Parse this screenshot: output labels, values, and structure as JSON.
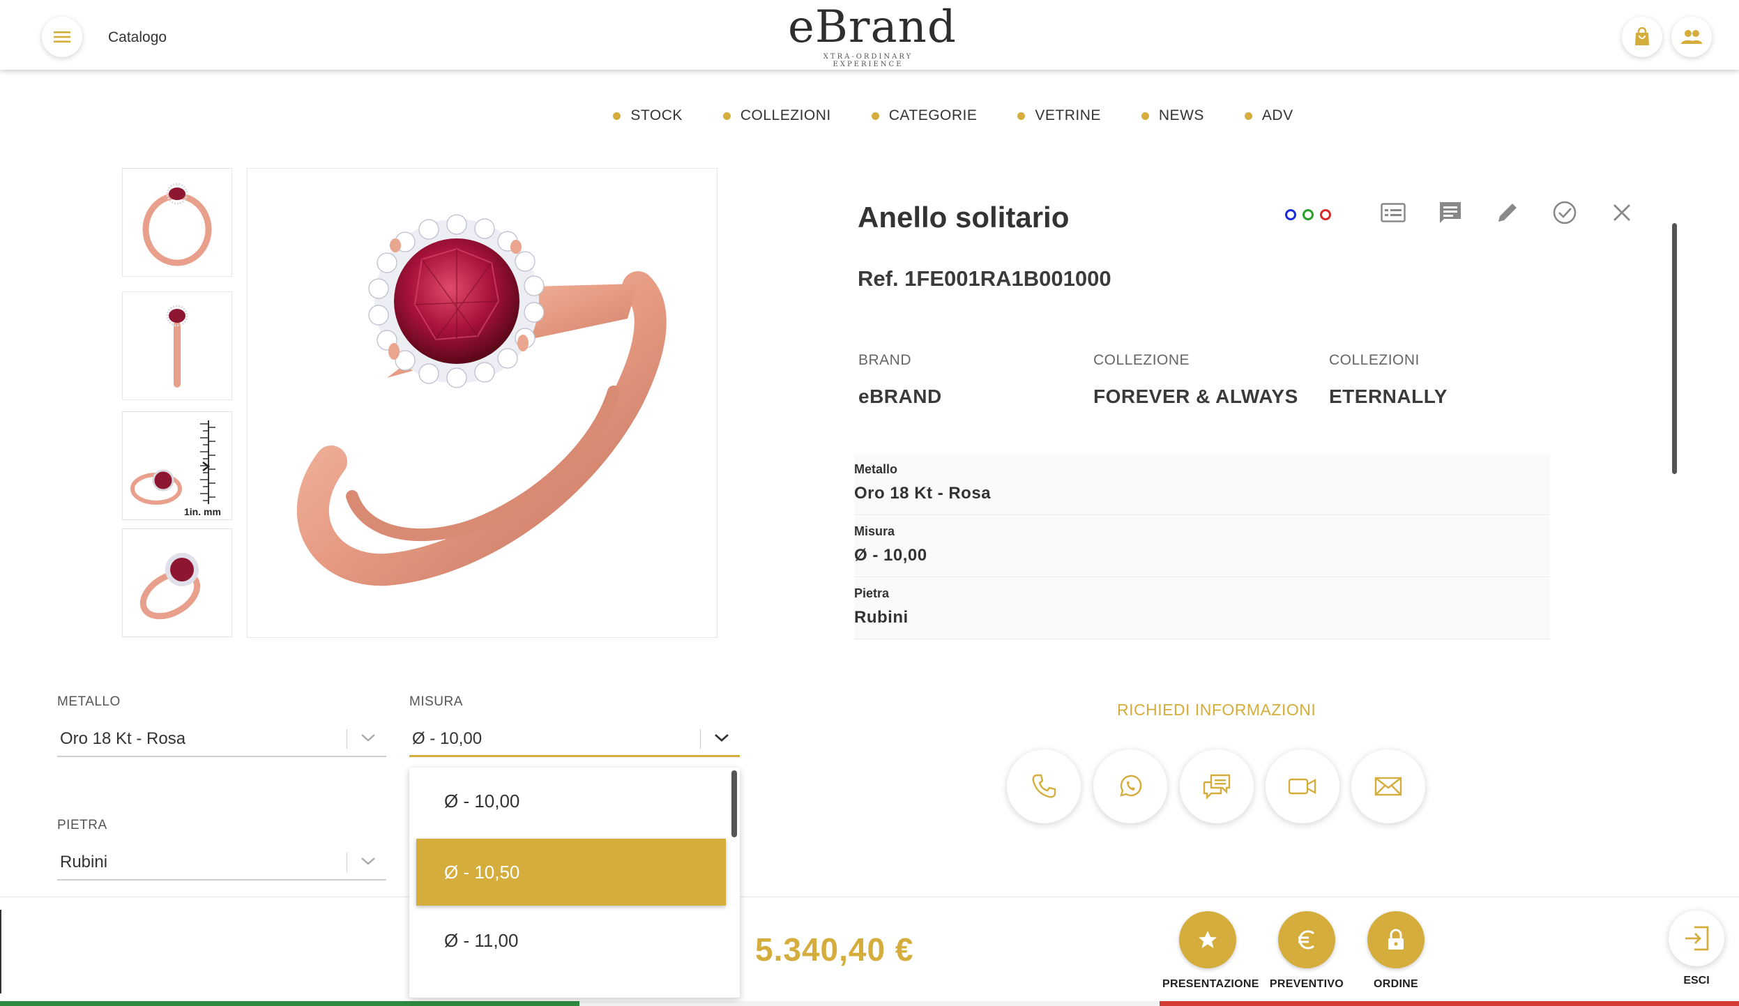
{
  "header": {
    "catalog_label": "Catalogo",
    "logo_word": "eBrand",
    "logo_tagline": "XTRA-ORDINARY EXPERIENCE",
    "menu_icon": "hamburger-icon",
    "cart_icon": "shopping-bag-icon",
    "users_icon": "users-icon"
  },
  "nav": {
    "items": [
      {
        "label": "STOCK"
      },
      {
        "label": "COLLEZIONI"
      },
      {
        "label": "CATEGORIE"
      },
      {
        "label": "VETRINE"
      },
      {
        "label": "NEWS"
      },
      {
        "label": "ADV"
      }
    ]
  },
  "gallery": {
    "scale_label": "1in.  mm"
  },
  "product": {
    "title": "Anello solitario",
    "ref": "Ref. 1FE001RA1B001000",
    "color_dots": [
      "#1a2ad6",
      "#2aa02a",
      "#d62a2a"
    ],
    "attributes": [
      {
        "label": "BRAND",
        "value": "eBRAND"
      },
      {
        "label": "COLLEZIONE",
        "value": "FOREVER & ALWAYS"
      },
      {
        "label": "COLLEZIONI",
        "value": "ETERNALLY"
      }
    ],
    "specs": [
      {
        "label": "Metallo",
        "value": "Oro 18 Kt - Rosa"
      },
      {
        "label": "Misura",
        "value": "Ø - 10,00"
      },
      {
        "label": "Pietra",
        "value": "Rubini"
      }
    ]
  },
  "selectors": {
    "metallo": {
      "label": "METALLO",
      "value": "Oro 18 Kt - Rosa"
    },
    "misura": {
      "label": "MISURA",
      "value": "Ø - 10,00"
    },
    "pietra": {
      "label": "PIETRA",
      "value": "Rubini"
    }
  },
  "dropdown": {
    "options": [
      "Ø - 10,00",
      "Ø - 10,50",
      "Ø - 11,00"
    ],
    "highlighted": "Ø - 10,50"
  },
  "contact": {
    "title": "RICHIEDI INFORMAZIONI"
  },
  "footer": {
    "price": "5.340,40 €",
    "actions": [
      {
        "label": "PRESENTAZIONE",
        "icon": "star-icon"
      },
      {
        "label": "PREVENTIVO",
        "icon": "euro-icon"
      },
      {
        "label": "ORDINE",
        "icon": "lock-icon"
      }
    ],
    "exit_label": "ESCI"
  },
  "colors": {
    "accent": "#d5ad3c",
    "flag_green": "#2e8b3e",
    "flag_white": "#f2f2f2",
    "flag_red": "#d43a36"
  }
}
